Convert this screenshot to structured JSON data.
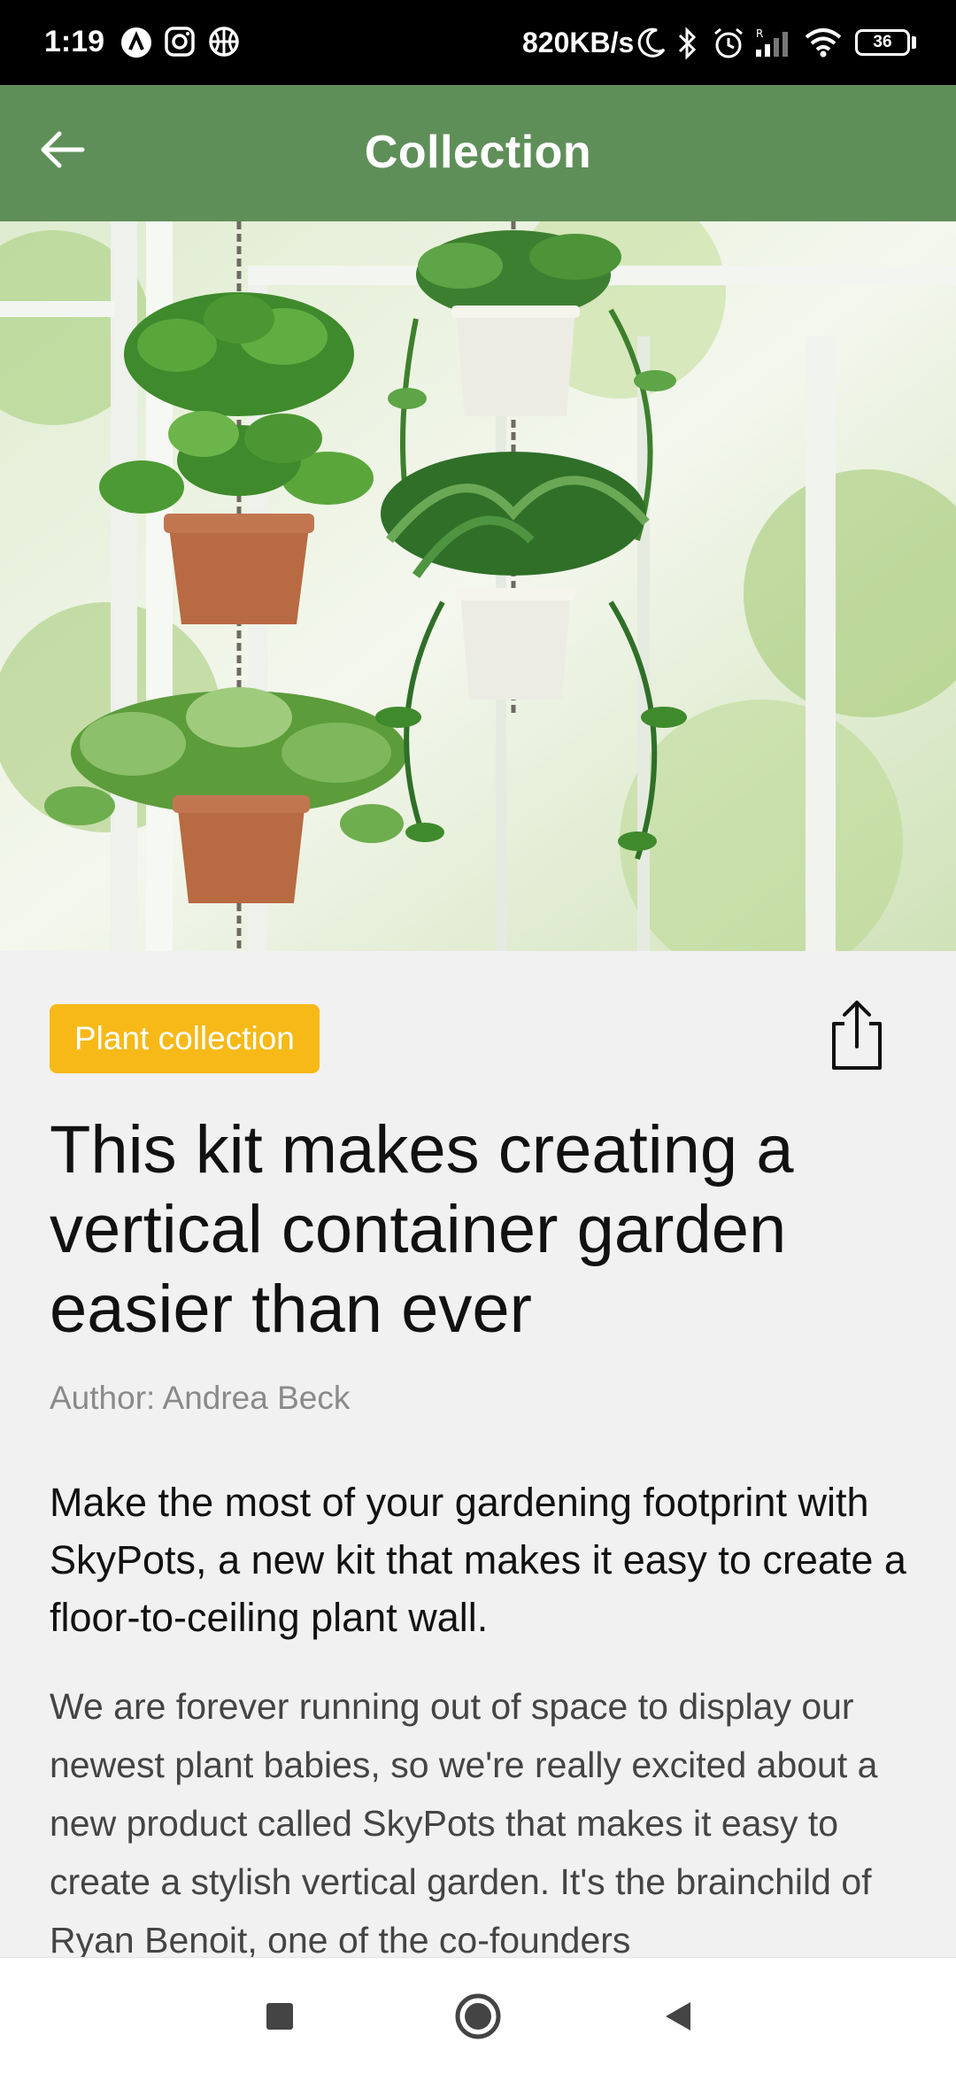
{
  "status_bar": {
    "time": "1:19",
    "net_speed": "820KB/s",
    "battery": "36",
    "left_icons": [
      "a-badge-icon",
      "instagram-icon",
      "basketball-icon"
    ],
    "right_icons": [
      "moon-icon",
      "bluetooth-icon",
      "alarm-icon",
      "signal-icon",
      "wifi-icon",
      "battery-icon"
    ]
  },
  "app_bar": {
    "title": "Collection",
    "background": "#5f8f59",
    "back_icon": "arrow-left-icon"
  },
  "article": {
    "category": "Plant collection",
    "category_color": "#f6b918",
    "share_icon": "share-icon",
    "title": "This kit makes creating a vertical container garden easier than ever",
    "author": "Author: Andrea Beck",
    "lede": "Make the most of your gardening footprint with SkyPots, a new kit that makes it easy to create a floor-to-ceiling plant wall.",
    "body": "We are forever running out of space to display our newest plant babies, so we're really excited about a new product called SkyPots that makes it easy to create a stylish vertical garden. It's the brainchild of Ryan Benoit, one of the co-founders"
  },
  "nav_bar": {
    "buttons": [
      "recents-square-icon",
      "home-circle-icon",
      "back-triangle-icon"
    ]
  }
}
